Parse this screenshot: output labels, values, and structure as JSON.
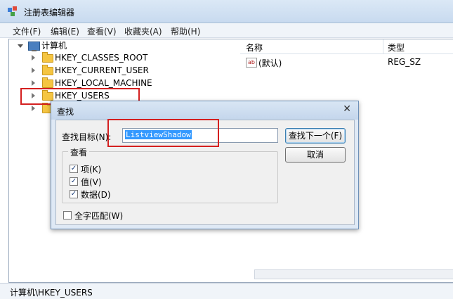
{
  "window": {
    "title": "注册表编辑器"
  },
  "menu": [
    "文件(F)",
    "编辑(E)",
    "查看(V)",
    "收藏夹(A)",
    "帮助(H)"
  ],
  "tree": {
    "root": "计算机",
    "items": [
      "HKEY_CLASSES_ROOT",
      "HKEY_CURRENT_USER",
      "HKEY_LOCAL_MACHINE",
      "HKEY_USERS"
    ]
  },
  "list": {
    "col_name": "名称",
    "col_type": "类型",
    "rows": [
      {
        "name": "(默认)",
        "type": "REG_SZ",
        "icon": "ab-icon"
      }
    ]
  },
  "status": "计算机\\HKEY_USERS",
  "dialog": {
    "title": "查找",
    "close": "✕",
    "find_label": "查找目标(N):",
    "find_value": "ListviewShadow",
    "find_next": "查找下一个(F)",
    "cancel": "取消",
    "look_at": "查看",
    "options": [
      {
        "label": "项(K)",
        "checked": true
      },
      {
        "label": "值(V)",
        "checked": true
      },
      {
        "label": "数据(D)",
        "checked": true
      }
    ],
    "match_whole": {
      "label": "全字匹配(W)",
      "checked": false
    }
  },
  "colors": {
    "highlight": "#d42020",
    "selection": "#3399ff"
  }
}
